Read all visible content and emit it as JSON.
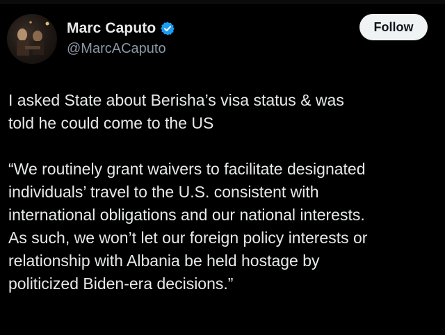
{
  "author": {
    "display_name": "Marc Caputo",
    "handle": "@MarcACaputo",
    "verified_icon": "verified-badge-icon",
    "avatar": "profile-photo"
  },
  "follow_button": {
    "label": "Follow"
  },
  "tweet": {
    "lines": [
      "I asked State about Berisha’s visa status & was",
      "told he could come to the US"
    ],
    "quote_lines": [
      "“We routinely grant waivers to facilitate designated",
      "individuals’ travel to the U.S. consistent with",
      "international obligations and our national interests.",
      "As such, we won’t let our foreign policy interests or",
      "relationship with Albania be held hostage by",
      "politicized Biden-era decisions.”"
    ]
  },
  "colors": {
    "background": "#000000",
    "text": "#e7e9ea",
    "secondary_text": "#8b98a5",
    "verified": "#1d9bf0",
    "button_bg": "#eff3f4",
    "button_text": "#0f1419"
  }
}
